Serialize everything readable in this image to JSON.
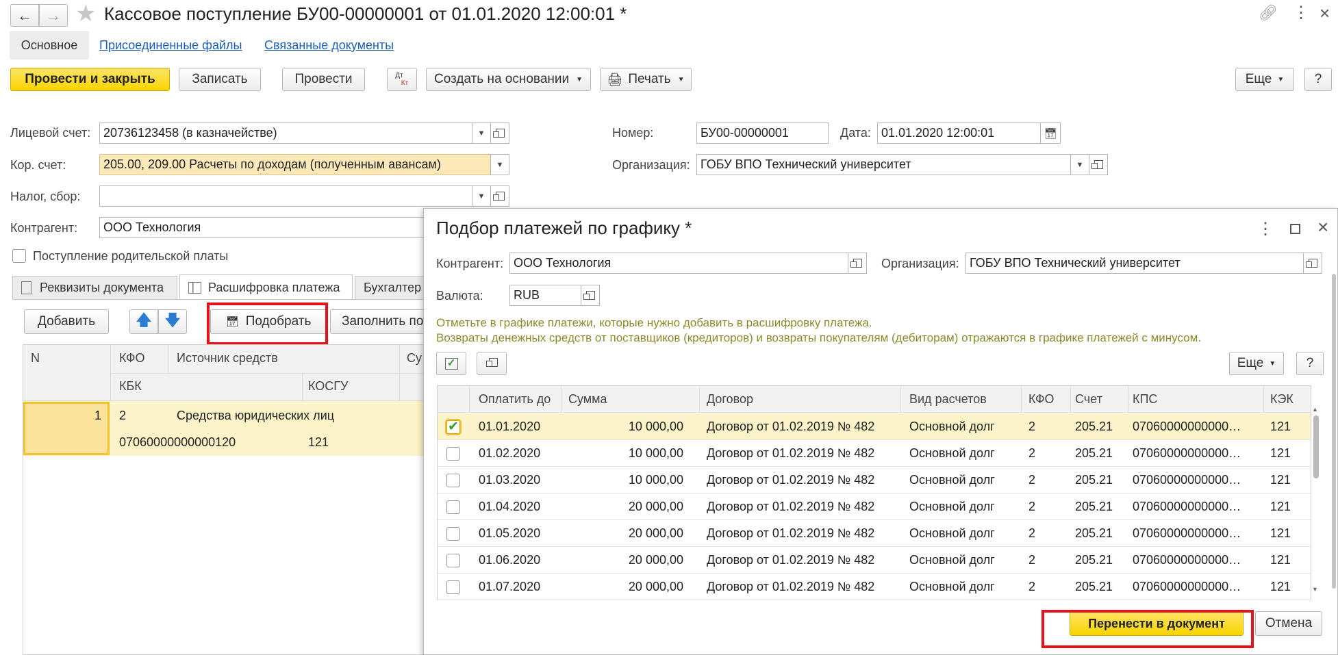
{
  "window": {
    "title": "Кассовое поступление БУ00-00000001 от 01.01.2020 12:00:01 *"
  },
  "nav_tabs": {
    "main": "Основное",
    "files": "Присоединенные файлы",
    "related": "Связанные документы"
  },
  "toolbar": {
    "post_close": "Провести и закрыть",
    "save": "Записать",
    "post": "Провести",
    "dtkt_top": "Дт",
    "dtkt_bottom": "Кт",
    "create_based": "Создать на основании",
    "print": "Печать",
    "more": "Еще",
    "help": "?"
  },
  "form": {
    "account_label": "Лицевой счет:",
    "account_value": "20736123458 (в казначействе)",
    "corr_label": "Кор. счет:",
    "corr_value": "205.00, 209.00 Расчеты по доходам (полученным авансам)",
    "tax_label": "Налог, сбор:",
    "tax_value": "",
    "contractor_label": "Контрагент:",
    "contractor_value": "ООО Технология",
    "parent_pay_label": "Поступление родительской платы",
    "number_label": "Номер:",
    "number_value": "БУ00-00000001",
    "date_label": "Дата:",
    "date_value": "01.01.2020 12:00:01",
    "org_label": "Организация:",
    "org_value": "ГОБУ ВПО Технический университет"
  },
  "doc_tabs": {
    "requisites": "Реквизиты документа",
    "breakdown": "Расшифровка платежа",
    "accounting": "Бухгалтер"
  },
  "breakdown": {
    "add": "Добавить",
    "select": "Подобрать",
    "fill": "Заполнить по",
    "headers": {
      "n": "N",
      "kfo": "КФО",
      "source": "Источник средств",
      "sum_short": "Су",
      "kbk": "КБК",
      "kosgu": "КОСГУ"
    },
    "row": {
      "n": "1",
      "kfo": "2",
      "source": "Средства юридических лиц",
      "kbk": "07060000000000120",
      "kosgu": "121"
    }
  },
  "dialog": {
    "title": "Подбор платежей по графику *",
    "contractor_label": "Контрагент:",
    "contractor_value": "ООО Технология",
    "org_label": "Организация:",
    "org_value": "ГОБУ ВПО Технический университет",
    "currency_label": "Валюта:",
    "currency_value": "RUB",
    "hint1": "Отметьте в графике платежи, которые нужно добавить в расшифровку платежа.",
    "hint2": "Возвраты денежных средств от поставщиков (кредиторов) и возвраты покупателям (дебиторам) отражаются в графике платежей с минусом.",
    "more": "Еще",
    "help": "?",
    "transfer": "Перенести в документ",
    "cancel": "Отмена",
    "columns": {
      "pay_until": "Оплатить до",
      "sum": "Сумма",
      "contract": "Договор",
      "calc_type": "Вид расчетов",
      "kfo": "КФО",
      "account": "Счет",
      "kps": "КПС",
      "kek": "КЭК"
    },
    "rows": [
      {
        "checked": true,
        "date": "01.01.2020",
        "sum": "10 000,00",
        "contract": "Договор от 01.02.2019 № 482",
        "calc": "Основной долг",
        "kfo": "2",
        "account": "205.21",
        "kps": "07060000000000…",
        "kek": "121"
      },
      {
        "checked": false,
        "date": "01.02.2020",
        "sum": "10 000,00",
        "contract": "Договор от 01.02.2019 № 482",
        "calc": "Основной долг",
        "kfo": "2",
        "account": "205.21",
        "kps": "07060000000000…",
        "kek": "121"
      },
      {
        "checked": false,
        "date": "01.03.2020",
        "sum": "10 000,00",
        "contract": "Договор от 01.02.2019 № 482",
        "calc": "Основной долг",
        "kfo": "2",
        "account": "205.21",
        "kps": "07060000000000…",
        "kek": "121"
      },
      {
        "checked": false,
        "date": "01.04.2020",
        "sum": "20 000,00",
        "contract": "Договор от 01.02.2019 № 482",
        "calc": "Основной долг",
        "kfo": "2",
        "account": "205.21",
        "kps": "07060000000000…",
        "kek": "121"
      },
      {
        "checked": false,
        "date": "01.05.2020",
        "sum": "20 000,00",
        "contract": "Договор от 01.02.2019 № 482",
        "calc": "Основной долг",
        "kfo": "2",
        "account": "205.21",
        "kps": "07060000000000…",
        "kek": "121"
      },
      {
        "checked": false,
        "date": "01.06.2020",
        "sum": "20 000,00",
        "contract": "Договор от 01.02.2019 № 482",
        "calc": "Основной долг",
        "kfo": "2",
        "account": "205.21",
        "kps": "07060000000000…",
        "kek": "121"
      },
      {
        "checked": false,
        "date": "01.07.2020",
        "sum": "20 000,00",
        "contract": "Договор от 01.02.2019 № 482",
        "calc": "Основной долг",
        "kfo": "2",
        "account": "205.21",
        "kps": "07060000000000…",
        "kek": "121"
      }
    ]
  },
  "colors": {
    "accent_yellow": "#f8d400",
    "highlight_row": "#fdf3c8",
    "link_blue": "#1e5fb4",
    "annotation_red": "#e4131a"
  }
}
